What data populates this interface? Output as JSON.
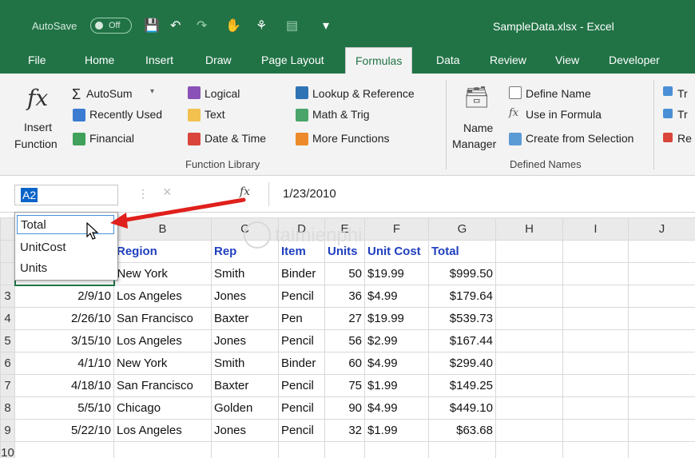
{
  "titlebar": {
    "autosave_label": "AutoSave",
    "autosave_state": "Off",
    "title": "SampleData.xlsx  -  Excel"
  },
  "tabs": [
    "File",
    "Home",
    "Insert",
    "Draw",
    "Page Layout",
    "Formulas",
    "Data",
    "Review",
    "View",
    "Developer"
  ],
  "active_tab": "Formulas",
  "ribbon": {
    "insert_function": {
      "line1": "Insert",
      "line2": "Function"
    },
    "autosum": "AutoSum",
    "recently_used": "Recently Used",
    "financial": "Financial",
    "logical": "Logical",
    "text": "Text",
    "date_time": "Date & Time",
    "lookup_reference": "Lookup & Reference",
    "math_trig": "Math & Trig",
    "more_functions": "More Functions",
    "function_library_label": "Function Library",
    "name_manager": {
      "line1": "Name",
      "line2": "Manager"
    },
    "define_name": "Define Name",
    "use_in_formula": "Use in Formula",
    "create_from_selection": "Create from Selection",
    "defined_names_label": "Defined Names",
    "trace_1": "Tr",
    "trace_2": "Tr",
    "trace_3": "Re"
  },
  "formula_bar": {
    "name_box": "A2",
    "fx": "fx",
    "value": "1/23/2010"
  },
  "name_dropdown": {
    "items": [
      "Total",
      "UnitCost",
      "Units"
    ],
    "highlighted": "Total"
  },
  "grid": {
    "columns": [
      "",
      "B",
      "C",
      "D",
      "E",
      "F",
      "G",
      "H",
      "I",
      "J"
    ],
    "header_row": {
      "row": "",
      "A": "",
      "B": "Region",
      "C": "Rep",
      "D": "Item",
      "E": "Units",
      "F": "Unit Cost",
      "G": "Total"
    },
    "rows": [
      {
        "row": "",
        "A": "",
        "B": "New York",
        "C": "Smith",
        "D": "Binder",
        "E": "50",
        "F": "$19.99",
        "G": "$999.50"
      },
      {
        "row": "3",
        "A": "2/9/10",
        "B": "Los Angeles",
        "C": "Jones",
        "D": "Pencil",
        "E": "36",
        "F": "$4.99",
        "G": "$179.64"
      },
      {
        "row": "4",
        "A": "2/26/10",
        "B": "San Francisco",
        "C": "Baxter",
        "D": "Pen",
        "E": "27",
        "F": "$19.99",
        "G": "$539.73"
      },
      {
        "row": "5",
        "A": "3/15/10",
        "B": "Los Angeles",
        "C": "Jones",
        "D": "Pencil",
        "E": "56",
        "F": "$2.99",
        "G": "$167.44"
      },
      {
        "row": "6",
        "A": "4/1/10",
        "B": "New York",
        "C": "Smith",
        "D": "Binder",
        "E": "60",
        "F": "$4.99",
        "G": "$299.40"
      },
      {
        "row": "7",
        "A": "4/18/10",
        "B": "San Francisco",
        "C": "Baxter",
        "D": "Pencil",
        "E": "75",
        "F": "$1.99",
        "G": "$149.25"
      },
      {
        "row": "8",
        "A": "5/5/10",
        "B": "Chicago",
        "C": "Golden",
        "D": "Pencil",
        "E": "90",
        "F": "$4.99",
        "G": "$449.10"
      },
      {
        "row": "9",
        "A": "5/22/10",
        "B": "Los Angeles",
        "C": "Jones",
        "D": "Pencil",
        "E": "32",
        "F": "$1.99",
        "G": "$63.68"
      },
      {
        "row": "10",
        "A": "",
        "B": "",
        "C": "",
        "D": "",
        "E": "",
        "F": "",
        "G": ""
      }
    ]
  },
  "watermark": "taimienphi",
  "colors": {
    "excel_green": "#217346",
    "header_blue": "#1f3fbf",
    "arrow_red": "#e0201c"
  }
}
